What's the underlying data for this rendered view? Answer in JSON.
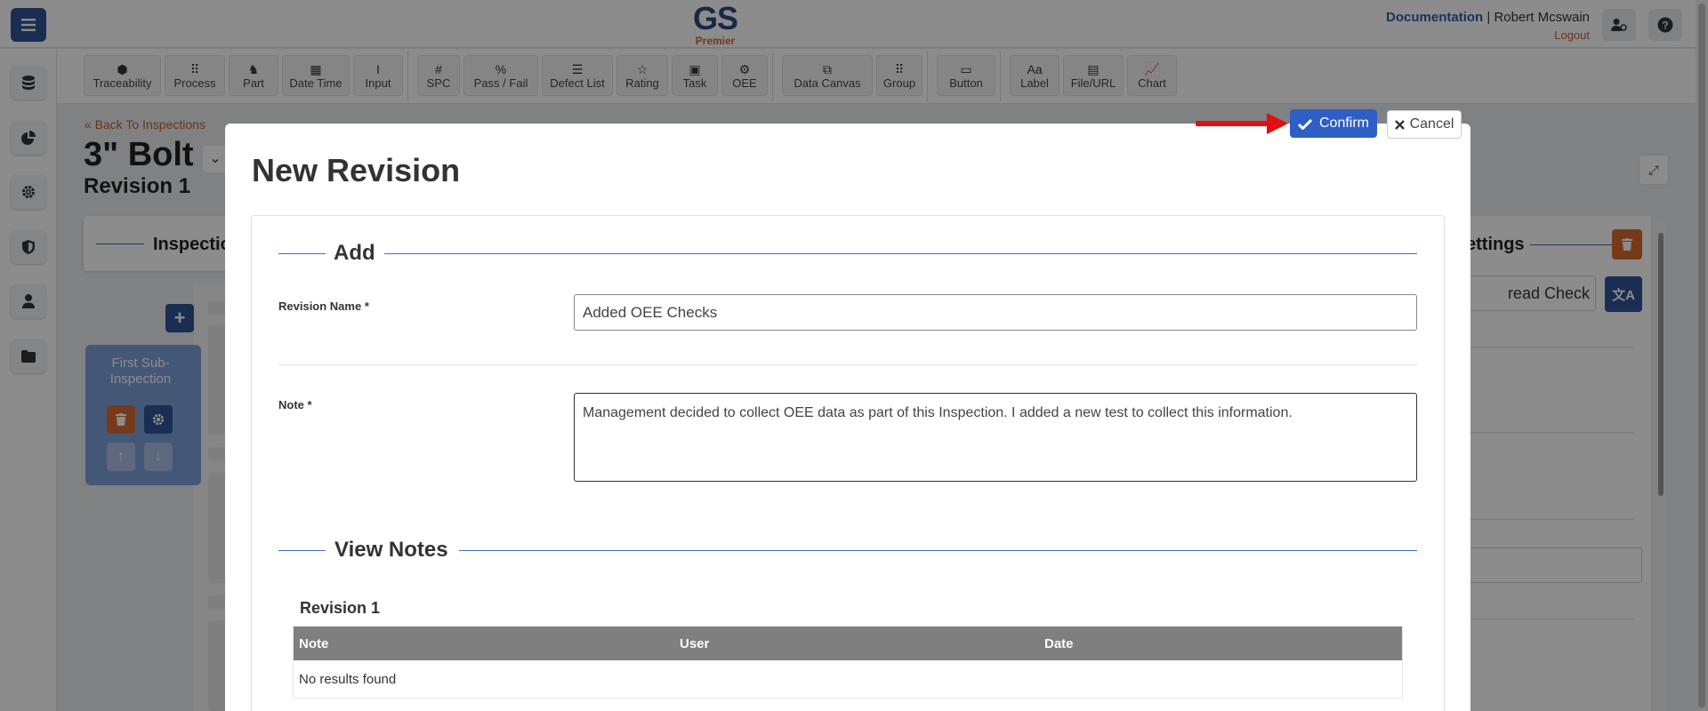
{
  "app": {
    "logo_text": "GS",
    "logo_sub": "Premier",
    "documentation_link": "Documentation",
    "separator": "|",
    "user_name": "Robert Mcswain",
    "logout_link": "Logout"
  },
  "toolbar": {
    "items": [
      {
        "label": "Traceability",
        "icon": "tag-icon",
        "glyph": "⬢"
      },
      {
        "label": "Process",
        "icon": "process-icon",
        "glyph": "⠿"
      },
      {
        "label": "Part",
        "icon": "part-icon",
        "glyph": "♞"
      },
      {
        "label": "Date Time",
        "icon": "calendar-icon",
        "glyph": "▦"
      },
      {
        "label": "Input",
        "icon": "text-cursor-icon",
        "glyph": "I"
      },
      {
        "label": "SPC",
        "icon": "hash-icon",
        "glyph": "#"
      },
      {
        "label": "Pass / Fail",
        "icon": "pass-fail-icon",
        "glyph": "%"
      },
      {
        "label": "Defect List",
        "icon": "list-icon",
        "glyph": "☰"
      },
      {
        "label": "Rating",
        "icon": "star-icon",
        "glyph": "☆"
      },
      {
        "label": "Task",
        "icon": "clipboard-check-icon",
        "glyph": "▣"
      },
      {
        "label": "OEE",
        "icon": "oee-icon",
        "glyph": "⚙"
      },
      {
        "label": "Data Canvas",
        "icon": "canvas-icon",
        "glyph": "⧉"
      },
      {
        "label": "Group",
        "icon": "grid-icon",
        "glyph": "⠿"
      },
      {
        "label": "Button",
        "icon": "paint-roller-icon",
        "glyph": "▭"
      },
      {
        "label": "Label",
        "icon": "label-icon",
        "glyph": "Aa"
      },
      {
        "label": "File/URL",
        "icon": "file-icon",
        "glyph": "▤"
      },
      {
        "label": "Chart",
        "icon": "chart-icon",
        "glyph": "📈"
      }
    ]
  },
  "page": {
    "back_link": "« Back To Inspections",
    "title": "3\" Bolt",
    "caret": "⌄",
    "revision": "Revision 1",
    "inspection_card": "Inspection",
    "sub_inspection": "First Sub-Inspection",
    "settings_title": "ettings",
    "name_value": "read Check"
  },
  "modal": {
    "title": "New Revision",
    "confirm_label": "Confirm",
    "cancel_label": "Cancel",
    "add_section": "Add",
    "revision_name_label": "Revision Name *",
    "revision_name_value": "Added OEE Checks",
    "note_label": "Note *",
    "note_value": "Management decided to collect OEE data as part of this Inspection. I added a new test to collect this information.",
    "view_notes_section": "View Notes",
    "notes_revision": "Revision 1",
    "table": {
      "headers": [
        "Note",
        "User",
        "Date"
      ],
      "empty_message": "No results found"
    }
  },
  "colors": {
    "primary": "#2f5496",
    "confirm": "#2f5fc5",
    "accent_orange": "#c0622d",
    "danger": "#d86a30",
    "arrow": "#e01010"
  }
}
